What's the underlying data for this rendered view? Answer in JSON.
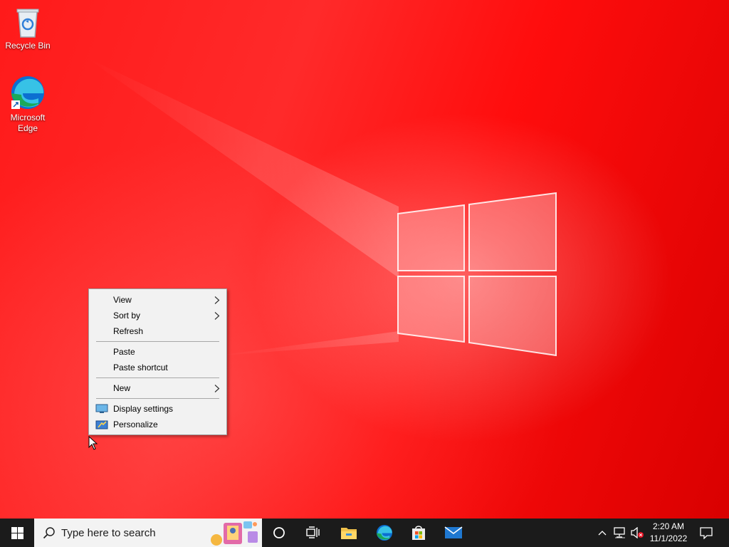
{
  "desktop": {
    "icons": [
      {
        "label": "Recycle Bin",
        "icon": "recycle-bin-icon"
      },
      {
        "label": "Microsoft Edge",
        "label_line1": "Microsoft",
        "label_line2": "Edge",
        "icon": "edge-icon"
      }
    ],
    "accent_color": "#ff0000"
  },
  "context_menu": {
    "items": [
      {
        "label": "View",
        "submenu": true
      },
      {
        "label": "Sort by",
        "submenu": true
      },
      {
        "label": "Refresh"
      },
      {
        "label": "Paste"
      },
      {
        "label": "Paste shortcut"
      },
      {
        "label": "New",
        "submenu": true
      },
      {
        "label": "Display settings",
        "icon": "display-settings-icon"
      },
      {
        "label": "Personalize",
        "icon": "personalize-icon"
      }
    ]
  },
  "taskbar": {
    "search_placeholder": "Type here to search",
    "pinned": [
      "cortana-icon",
      "task-view-icon",
      "file-explorer-icon",
      "edge-icon",
      "microsoft-store-icon",
      "mail-icon"
    ],
    "tray": [
      "chevron-up-icon",
      "network-icon",
      "volume-muted-icon"
    ],
    "time": "2:20 AM",
    "date": "11/1/2022",
    "notifications_icon": "action-center-icon"
  }
}
